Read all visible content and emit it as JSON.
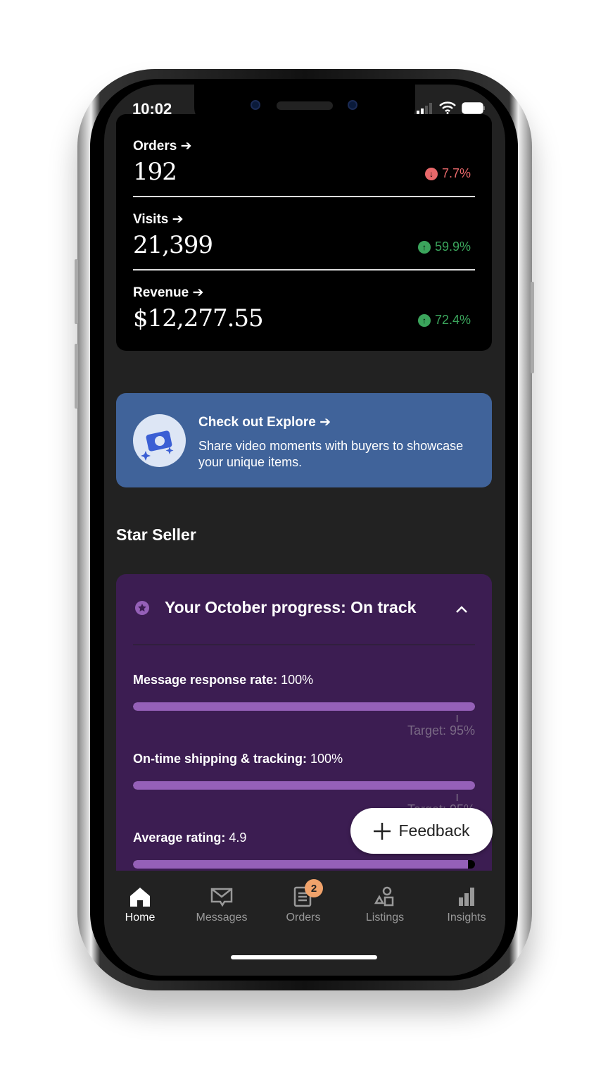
{
  "status_bar": {
    "time": "10:02"
  },
  "stats": [
    {
      "label": "Orders",
      "value": "192",
      "change": "7.7%",
      "direction": "down",
      "color": "#e8686a"
    },
    {
      "label": "Visits",
      "value": "21,399",
      "change": "59.9%",
      "direction": "up",
      "color": "#3ba55c"
    },
    {
      "label": "Revenue",
      "value": "$12,277.55",
      "change": "72.4%",
      "direction": "up",
      "color": "#3ba55c"
    }
  ],
  "explore": {
    "title": "Check out Explore",
    "description": "Share video moments with buyers to showcase your unique items.",
    "icon": "camera-sparkle-icon"
  },
  "star_seller": {
    "heading": "Star Seller",
    "progress_title": "Your October progress: On track",
    "metrics": [
      {
        "label": "Message response rate:",
        "value": "100%",
        "progress": 100,
        "target": "Target: 95%"
      },
      {
        "label": "On-time shipping & tracking:",
        "value": "100%",
        "progress": 100,
        "target": "Target: 95%"
      },
      {
        "label": "Average rating:",
        "value": "4.9",
        "progress": 98
      }
    ]
  },
  "feedback_button": "Feedback",
  "nav": [
    {
      "label": "Home",
      "icon": "home-icon",
      "active": true
    },
    {
      "label": "Messages",
      "icon": "messages-icon"
    },
    {
      "label": "Orders",
      "icon": "orders-icon",
      "badge": "2"
    },
    {
      "label": "Listings",
      "icon": "listings-icon"
    },
    {
      "label": "Insights",
      "icon": "insights-icon"
    }
  ],
  "colors": {
    "accent_purple": "#9560b8",
    "card_purple": "#3c1d52",
    "explore_blue": "#40639a",
    "badge": "#f1a36b"
  }
}
